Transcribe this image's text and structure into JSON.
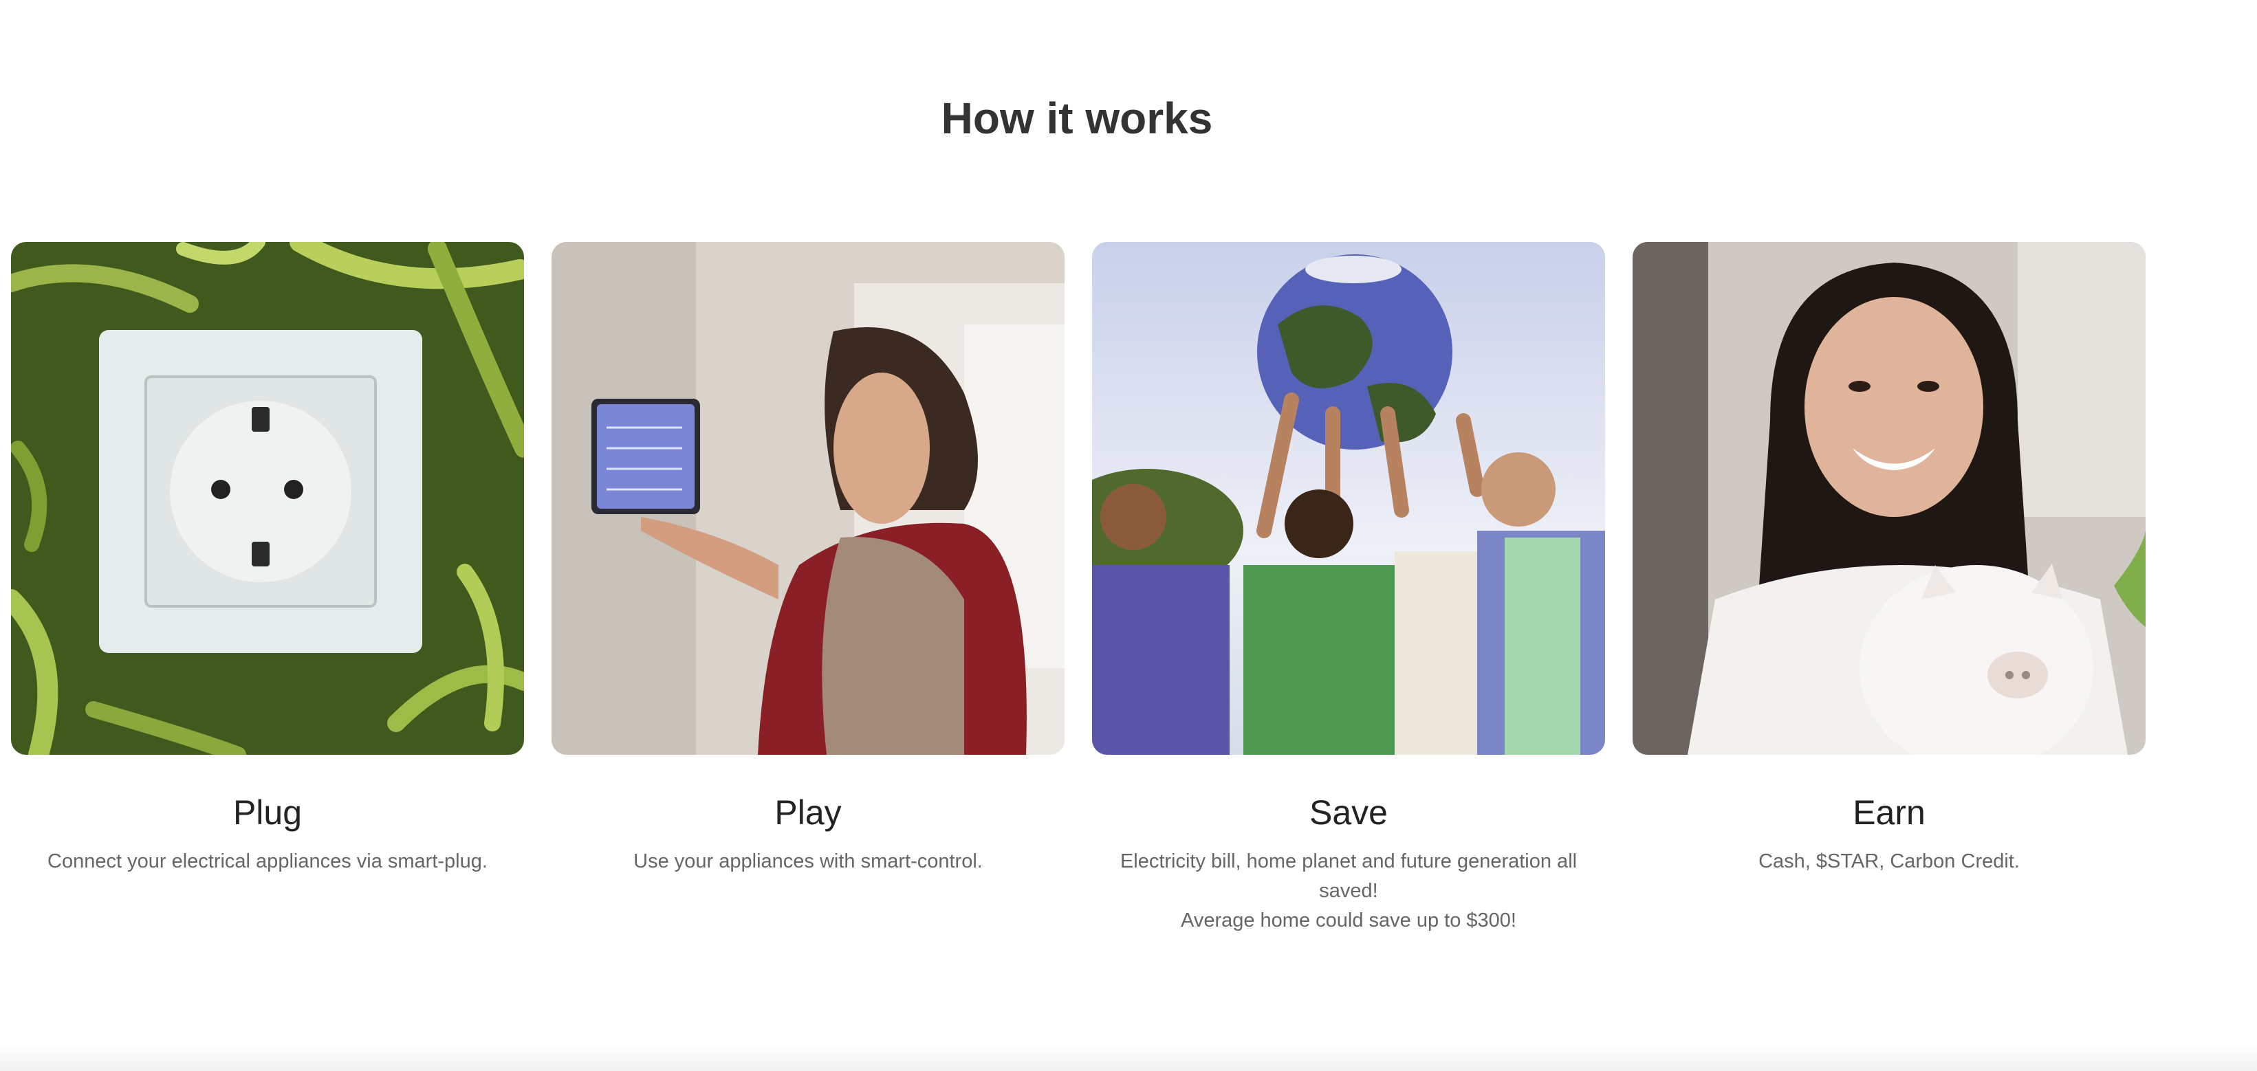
{
  "section": {
    "title": "How it works"
  },
  "cards": [
    {
      "title": "Plug",
      "description": [
        "Connect your electrical appliances via smart-plug."
      ],
      "image": "power-socket-on-grass-photo"
    },
    {
      "title": "Play",
      "description": [
        "Use your appliances with smart-control."
      ],
      "image": "woman-using-wall-tablet-photo"
    },
    {
      "title": "Save",
      "description": [
        "Electricity bill, home planet and future generation all saved!",
        "Average home could save up to $300!"
      ],
      "image": "children-holding-globe-photo"
    },
    {
      "title": "Earn",
      "description": [
        "Cash, $STAR, Carbon Credit."
      ],
      "image": "woman-with-piggy-bank-photo"
    }
  ],
  "colors": {
    "title": "#333333",
    "card_title": "#222222",
    "card_text": "#666666",
    "background": "#ffffff"
  }
}
